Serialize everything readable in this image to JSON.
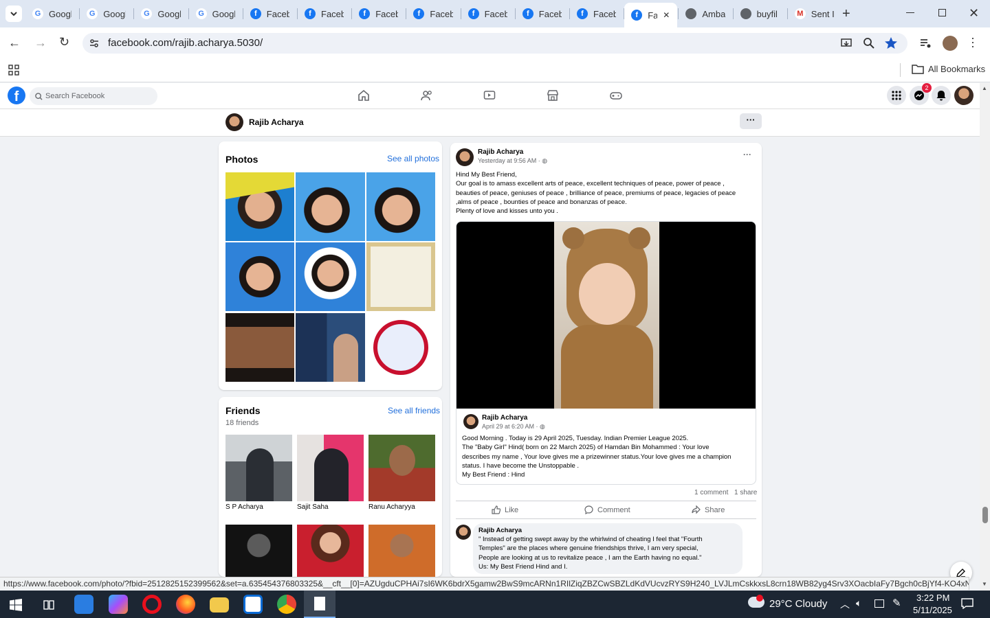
{
  "browser": {
    "tabs": [
      {
        "title": "Googl",
        "icon": "google"
      },
      {
        "title": "Googl",
        "icon": "google"
      },
      {
        "title": "Googl",
        "icon": "google"
      },
      {
        "title": "Googl",
        "icon": "google"
      },
      {
        "title": "Faceb",
        "icon": "facebook"
      },
      {
        "title": "Faceb",
        "icon": "facebook"
      },
      {
        "title": "Faceb",
        "icon": "facebook"
      },
      {
        "title": "Faceb",
        "icon": "facebook"
      },
      {
        "title": "Faceb",
        "icon": "facebook"
      },
      {
        "title": "Faceb",
        "icon": "facebook"
      },
      {
        "title": "Faceb",
        "icon": "facebook"
      },
      {
        "title": "Fa",
        "icon": "facebook",
        "active": true
      },
      {
        "title": "Amba",
        "icon": "globe"
      },
      {
        "title": "buyfil",
        "icon": "globe"
      },
      {
        "title": "Sent I",
        "icon": "gmail"
      }
    ],
    "url": "facebook.com/rajib.acharya.5030/",
    "bookmarks_label": "All Bookmarks",
    "status_url": "https://www.facebook.com/photo/?fbid=2512825152399562&set=a.635454376803325&__cft__[0]=AZUgduCPHAi7sI6WK6bdrX5gamw2BwS9mcARNn1RIlZiqZBZCwSBZLdKdVUcvzRYS9H240_LVJLmCskkxsL8crn18WB82yg4Srv3XOacbIaFy7Bgch0cBjYf4-KO4xNQ4F4..."
  },
  "facebook": {
    "search_placeholder": "Search Facebook",
    "notification_badge": "2",
    "profile_name": "Rajib Acharya",
    "more_label": "···"
  },
  "photos": {
    "title": "Photos",
    "see_all": "See all photos"
  },
  "friends": {
    "title": "Friends",
    "count": "18 friends",
    "see_all": "See all friends",
    "list": [
      {
        "name": "S P Acharya"
      },
      {
        "name": "Sajit Saha"
      },
      {
        "name": "Ranu Acharyya"
      }
    ]
  },
  "post": {
    "author": "Rajib Acharya",
    "time": "Yesterday at 9:56 AM · ",
    "text": [
      "Hind My Best Friend,",
      "Our goal is to amass excellent arts of peace, excellent techniques of peace, power of peace ,",
      "beauties of peace, geniuses of peace , brilliance of peace, premiums of peace, legacies of peace",
      ",alms of peace ,  bounties of peace  and bonanzas of peace.",
      "Plenty of love and kisses unto you ."
    ],
    "shared": {
      "author": "Rajib Acharya",
      "time": "April 29 at 6:20 AM · ",
      "text": [
        "Good Morning . Today is 29 April 2025, Tuesday. Indian Premier League 2025.",
        "The \"Baby Girl\" Hind( born on 22 March 2025) of Hamdan Bin Mohammed : Your love",
        "describes my name , Your love gives me a prizewinner status.Your love gives me a champion",
        "status. I have become the Unstoppable .",
        "My Best Friend : Hind"
      ]
    },
    "stats": {
      "comments": "1 comment",
      "shares": "1 share"
    },
    "actions": {
      "like": "Like",
      "comment": "Comment",
      "share": "Share"
    },
    "comment": {
      "author": "Rajib Acharya",
      "text": [
        "\" Instead of getting swept away by the whirlwind of cheating I feel that \"Fourth",
        "Temples\" are the places where genuine friendships thrive, I am very special,",
        "People are looking at us to revitalize peace , I am the Earth having no equal.\"",
        "Us: My Best Friend Hind and I."
      ]
    }
  },
  "taskbar": {
    "weather": "29°C  Cloudy",
    "time": "3:22 PM",
    "date": "5/11/2025"
  },
  "colors": {
    "fb_blue": "#1877f2",
    "link": "#216fdb",
    "tabbar": "#dfe7f3"
  }
}
